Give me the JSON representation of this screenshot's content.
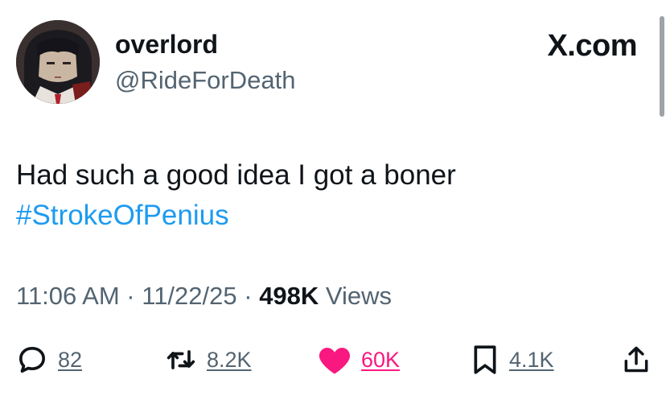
{
  "author": {
    "display_name": "overlord",
    "handle": "@RideForDeath",
    "avatar_icon": "pixel-art-character-avatar"
  },
  "brand": {
    "label": "X.com"
  },
  "tweet": {
    "text_line1": "Had such a good idea I got a boner",
    "hashtag": "#StrokeOfPenius"
  },
  "meta": {
    "time": "11:06 AM",
    "separator1": " · ",
    "date": "11/22/25",
    "separator2": " · ",
    "views_count": "498K",
    "views_label": " Views"
  },
  "actions": {
    "reply": {
      "icon": "reply-icon",
      "count": "82"
    },
    "retweet": {
      "icon": "retweet-icon",
      "count": "8.2K"
    },
    "like": {
      "icon": "heart-icon",
      "count": "60K",
      "color": "#f91880"
    },
    "bookmark": {
      "icon": "bookmark-icon",
      "count": "4.1K"
    },
    "share": {
      "icon": "share-icon"
    }
  },
  "colors": {
    "text": "#0f1419",
    "secondary": "#536471",
    "hashtag": "#1d9bf0",
    "like": "#f91880"
  }
}
